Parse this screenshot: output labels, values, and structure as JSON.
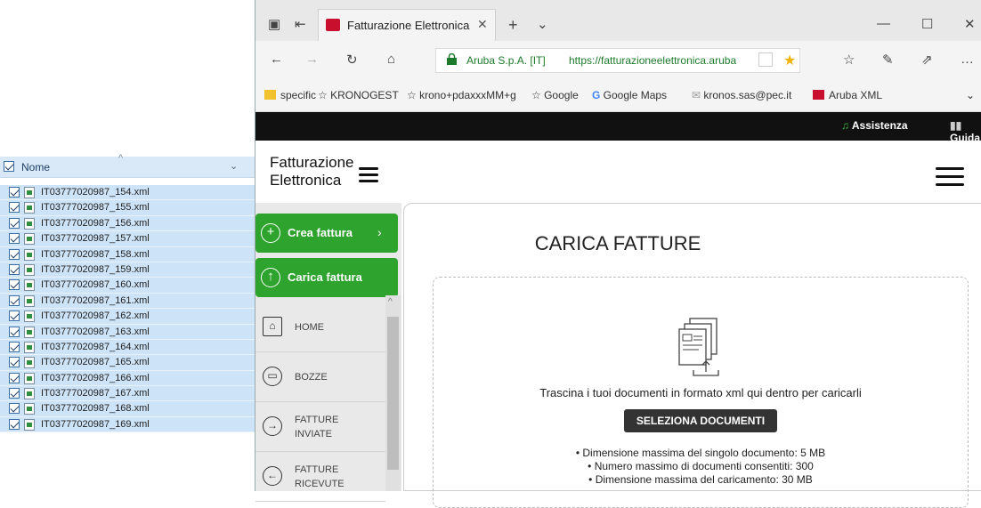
{
  "explorer": {
    "column_header": "Nome",
    "files": [
      "IT03777020987_154.xml",
      "IT03777020987_155.xml",
      "IT03777020987_156.xml",
      "IT03777020987_157.xml",
      "IT03777020987_158.xml",
      "IT03777020987_159.xml",
      "IT03777020987_160.xml",
      "IT03777020987_161.xml",
      "IT03777020987_162.xml",
      "IT03777020987_163.xml",
      "IT03777020987_164.xml",
      "IT03777020987_165.xml",
      "IT03777020987_166.xml",
      "IT03777020987_167.xml",
      "IT03777020987_168.xml",
      "IT03777020987_169.xml"
    ]
  },
  "browser": {
    "tab_title": "Fatturazione Elettronica",
    "address": {
      "site_identity": "Aruba S.p.A. [IT]",
      "url": "https://fatturazioneelettronica.aruba"
    },
    "favorites": [
      "specific",
      "KRONOGEST",
      "krono+pdaxxxMM+g",
      "Google",
      "Google Maps",
      "kronos.sas@pec.it",
      "Aruba XML"
    ],
    "topbar": {
      "assistenza": "Assistenza",
      "guida": "Guida"
    }
  },
  "site": {
    "logo_line1": "Fatturazione",
    "logo_line2": "Elettronica",
    "sidebar": {
      "crea_fattura": "Crea fattura",
      "carica_fattura": "Carica fattura",
      "nav": [
        {
          "label": "HOME"
        },
        {
          "label": "BOZZE"
        },
        {
          "label": "FATTURE INVIATE"
        },
        {
          "label": "FATTURE RICEVUTE"
        }
      ]
    },
    "main": {
      "title": "CARICA FATTURE",
      "drop_text": "Trascina i tuoi documenti in formato xml qui dentro per caricarli",
      "select_button": "SELEZIONA DOCUMENTI",
      "limits": [
        "• Dimensione massima del singolo documento: 5 MB",
        "• Numero massimo di documenti consentiti: 300",
        "• Dimensione massima del caricamento: 30 MB"
      ]
    }
  },
  "colors": {
    "green": "#2ea32e",
    "black_bar": "#111111",
    "selection_blue": "#cde3f7"
  }
}
